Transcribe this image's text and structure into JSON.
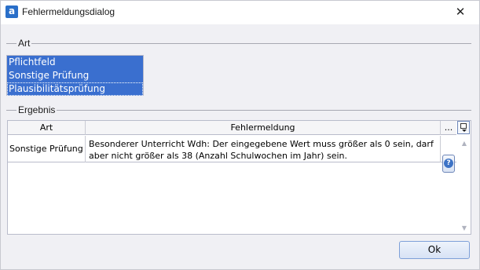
{
  "window": {
    "title": "Fehlermeldungsdialog",
    "app_icon_glyph": "a",
    "close_glyph": "✕"
  },
  "art_group": {
    "label": "Art",
    "items": [
      {
        "label": "Pflichtfeld",
        "selected": true
      },
      {
        "label": "Sonstige Prüfung",
        "selected": true
      },
      {
        "label": "Plausibilitätsprüfung",
        "selected": true
      }
    ]
  },
  "ergebnis_group": {
    "label": "Ergebnis",
    "columns": [
      "Art",
      "Fehlermeldung",
      "..."
    ],
    "rows": [
      {
        "art": "Sonstige Prüfung",
        "message": "Besonderer Unterricht Wdh: Der eingegebene Wert muss größer als 0 sein, darf aber nicht größer als 38 (Anzahl Schulwochen im Jahr) sein.",
        "help_glyph": "?"
      }
    ]
  },
  "buttons": {
    "ok_label": "Ok"
  },
  "colors": {
    "selection": "#3a6fcf",
    "window_bg": "#f0f0f4",
    "button_border": "#7ea0d8"
  }
}
